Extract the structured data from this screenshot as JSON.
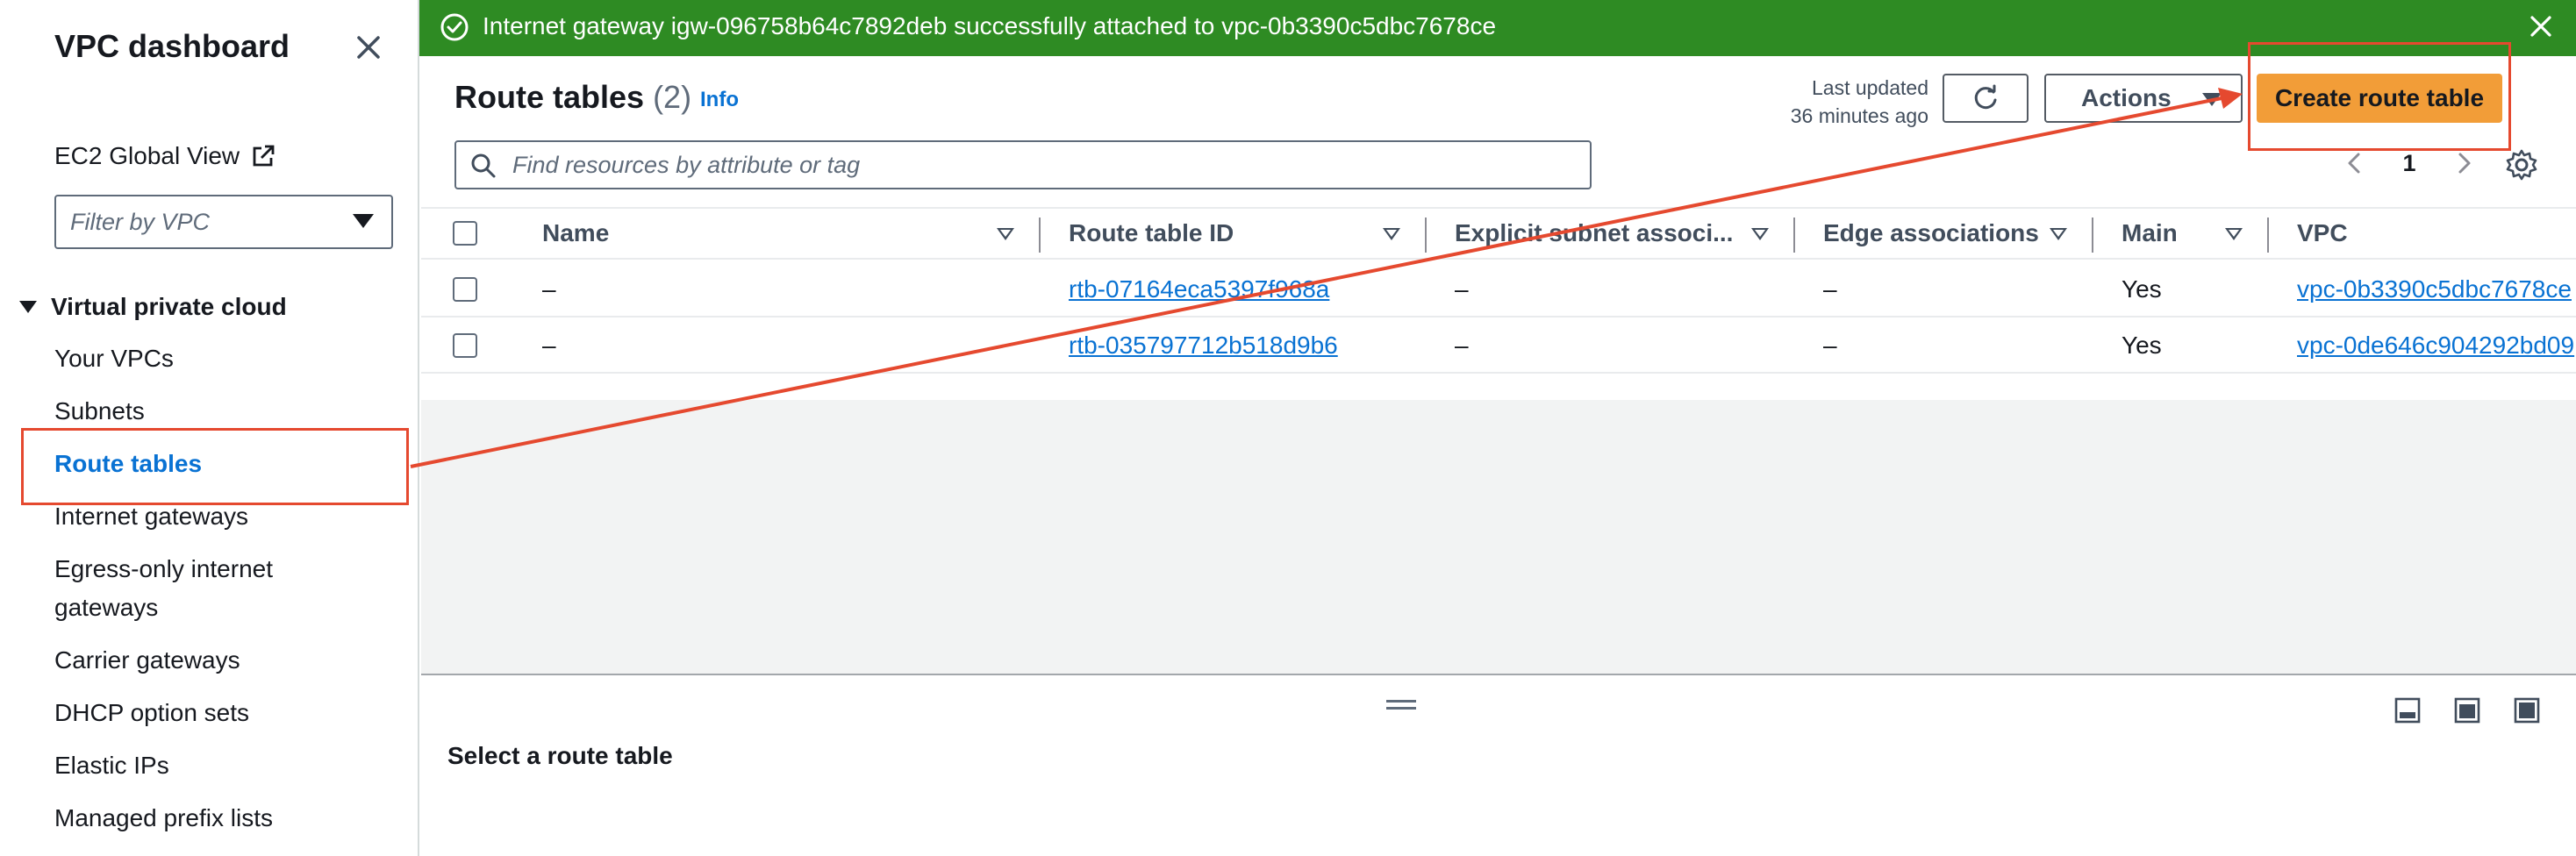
{
  "flash": {
    "message": "Internet gateway igw-096758b64c7892deb successfully attached to vpc-0b3390c5dbc7678ce"
  },
  "sidebar": {
    "title": "VPC dashboard",
    "global_view": "EC2 Global View",
    "filter_placeholder": "Filter by VPC",
    "section": "Virtual private cloud",
    "items": [
      {
        "label": "Your VPCs"
      },
      {
        "label": "Subnets"
      },
      {
        "label": "Route tables"
      },
      {
        "label": "Internet gateways"
      },
      {
        "label": "Egress-only internet"
      },
      {
        "label": "gateways"
      },
      {
        "label": "Carrier gateways"
      },
      {
        "label": "DHCP option sets"
      },
      {
        "label": "Elastic IPs"
      },
      {
        "label": "Managed prefix lists"
      }
    ]
  },
  "header": {
    "title": "Route tables",
    "count": "(2)",
    "info": "Info",
    "last_updated_line1": "Last updated",
    "last_updated_line2": "36 minutes ago",
    "actions_label": "Actions",
    "create_label": "Create route table",
    "search_placeholder": "Find resources by attribute or tag",
    "page": "1"
  },
  "table": {
    "columns": [
      "Name",
      "Route table ID",
      "Explicit subnet associ...",
      "Edge associations",
      "Main",
      "VPC"
    ],
    "rows": [
      {
        "name": "–",
        "id": "rtb-07164eca5397f968a",
        "explicit": "–",
        "edge": "–",
        "main": "Yes",
        "vpc": "vpc-0b3390c5dbc7678ce"
      },
      {
        "name": "–",
        "id": "rtb-035797712b518d9b6",
        "explicit": "–",
        "edge": "–",
        "main": "Yes",
        "vpc": "vpc-0de646c904292bd09"
      }
    ]
  },
  "split": {
    "title": "Select a route table"
  },
  "colors": {
    "flash_green": "#2e8b23",
    "primary_orange": "#f29d38",
    "link_blue": "#0972d3",
    "annotation_red": "#e5492f"
  }
}
